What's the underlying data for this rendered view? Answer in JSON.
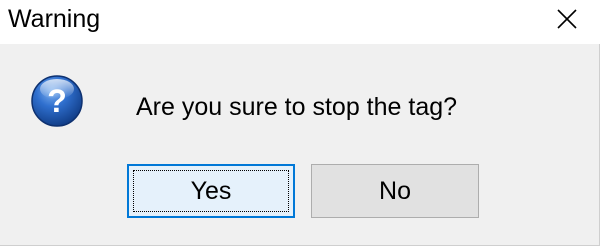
{
  "window": {
    "title": "Warning",
    "close_icon": "close-icon"
  },
  "dialog": {
    "icon": "question-icon",
    "message": "Are you sure to stop the tag?"
  },
  "buttons": {
    "yes_label": "Yes",
    "no_label": "No"
  },
  "colors": {
    "accent": "#0078d7",
    "icon_blue": "#1f5fb5",
    "body_background": "#f0f0f0"
  }
}
